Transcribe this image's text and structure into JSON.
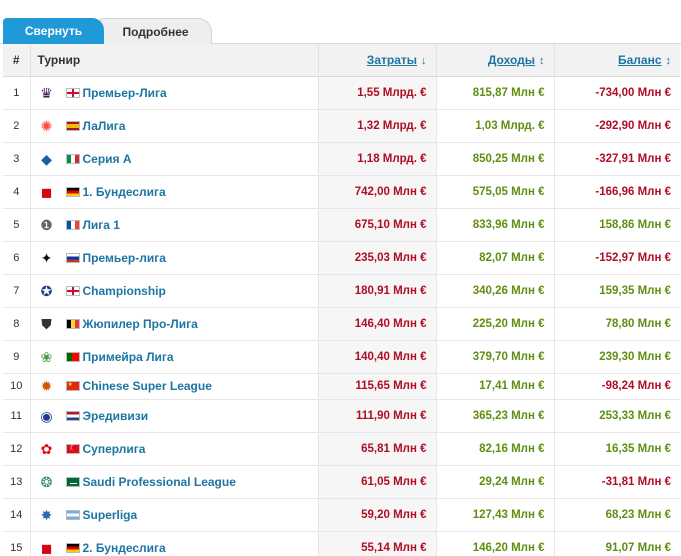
{
  "tabs": {
    "collapse_label": "Свернуть",
    "details_label": "Подробнее"
  },
  "headers": {
    "number": "#",
    "tournament": "Турнир",
    "spend": "Затраты",
    "income": "Доходы",
    "balance": "Баланс"
  },
  "colors": {
    "accent": "#1f9ad6",
    "link": "#1d75a3",
    "negative": "#b00d24",
    "positive": "#5e8f10"
  },
  "rows": [
    {
      "rank": "1",
      "flag": "flag-eng",
      "logo_icon": "premier-league-logo-icon",
      "logo_glyph": "♛",
      "name": "Премьер-Лига",
      "spend": "1,55 Млрд. €",
      "income": "815,87 Млн €",
      "balance": "-734,00 Млн €",
      "balance_sign": "neg"
    },
    {
      "rank": "2",
      "flag": "flag-esp",
      "logo_icon": "laliga-logo-icon",
      "logo_glyph": "✺",
      "name": "ЛаЛига",
      "spend": "1,32 Млрд. €",
      "income": "1,03 Млрд. €",
      "balance": "-292,90 Млн €",
      "balance_sign": "neg"
    },
    {
      "rank": "3",
      "flag": "flag-ita",
      "logo_icon": "serie-a-logo-icon",
      "logo_glyph": "◆",
      "name": "Серия А",
      "spend": "1,18 Млрд. €",
      "income": "850,25 Млн €",
      "balance": "-327,91 Млн €",
      "balance_sign": "neg"
    },
    {
      "rank": "4",
      "flag": "flag-ger",
      "logo_icon": "bundesliga-logo-icon",
      "logo_glyph": "◼",
      "name": "1. Бундеслига",
      "spend": "742,00 Млн €",
      "income": "575,05 Млн €",
      "balance": "-166,96 Млн €",
      "balance_sign": "neg"
    },
    {
      "rank": "5",
      "flag": "flag-fra",
      "logo_icon": "ligue-1-logo-icon",
      "logo_glyph": "❶",
      "name": "Лига 1",
      "spend": "675,10 Млн €",
      "income": "833,96 Млн €",
      "balance": "158,86 Млн €",
      "balance_sign": "pos"
    },
    {
      "rank": "6",
      "flag": "flag-rus",
      "logo_icon": "russian-premier-league-logo-icon",
      "logo_glyph": "✦",
      "name": "Премьер-лига",
      "spend": "235,03 Млн €",
      "income": "82,07 Млн €",
      "balance": "-152,97 Млн €",
      "balance_sign": "neg"
    },
    {
      "rank": "7",
      "flag": "flag-eng",
      "logo_icon": "championship-logo-icon",
      "logo_glyph": "✪",
      "name": "Championship",
      "spend": "180,91 Млн €",
      "income": "340,26 Млн €",
      "balance": "159,35 Млн €",
      "balance_sign": "pos"
    },
    {
      "rank": "8",
      "flag": "flag-bel",
      "logo_icon": "jupiler-pro-league-logo-icon",
      "logo_glyph": "⛊",
      "name": "Жюпилер Про-Лига",
      "spend": "146,40 Млн €",
      "income": "225,20 Млн €",
      "balance": "78,80 Млн €",
      "balance_sign": "pos"
    },
    {
      "rank": "9",
      "flag": "flag-por",
      "logo_icon": "primeira-liga-logo-icon",
      "logo_glyph": "❀",
      "name": "Примейра Лига",
      "spend": "140,40 Млн €",
      "income": "379,70 Млн €",
      "balance": "239,30 Млн €",
      "balance_sign": "pos"
    },
    {
      "rank": "10",
      "flag": "flag-chn",
      "logo_icon": "chinese-super-league-logo-icon",
      "logo_glyph": "✹",
      "name": "Chinese Super League",
      "spend": "115,65 Млн €",
      "income": "17,41 Млн €",
      "balance": "-98,24 Млн €",
      "balance_sign": "neg"
    },
    {
      "rank": "11",
      "flag": "flag-ned",
      "logo_icon": "eredivisie-logo-icon",
      "logo_glyph": "◉",
      "name": "Эредивизи",
      "spend": "111,90 Млн €",
      "income": "365,23 Млн €",
      "balance": "253,33 Млн €",
      "balance_sign": "pos"
    },
    {
      "rank": "12",
      "flag": "flag-tur",
      "logo_icon": "super-lig-logo-icon",
      "logo_glyph": "✿",
      "name": "Суперлига",
      "spend": "65,81 Млн €",
      "income": "82,16 Млн €",
      "balance": "16,35 Млн €",
      "balance_sign": "pos"
    },
    {
      "rank": "13",
      "flag": "flag-ksa",
      "logo_icon": "saudi-pro-league-logo-icon",
      "logo_glyph": "❂",
      "name": "Saudi Professional League",
      "spend": "61,05 Млн €",
      "income": "29,24 Млн €",
      "balance": "-31,81 Млн €",
      "balance_sign": "neg"
    },
    {
      "rank": "14",
      "flag": "flag-arg",
      "logo_icon": "superliga-logo-icon",
      "logo_glyph": "✸",
      "name": "Superliga",
      "spend": "59,20 Млн €",
      "income": "127,43 Млн €",
      "balance": "68,23 Млн €",
      "balance_sign": "pos"
    },
    {
      "rank": "15",
      "flag": "flag-ger",
      "logo_icon": "2-bundesliga-logo-icon",
      "logo_glyph": "◼",
      "name": "2. Бундеслига",
      "spend": "55,14 Млн €",
      "income": "146,20 Млн €",
      "balance": "91,07 Млн €",
      "balance_sign": "pos"
    }
  ]
}
